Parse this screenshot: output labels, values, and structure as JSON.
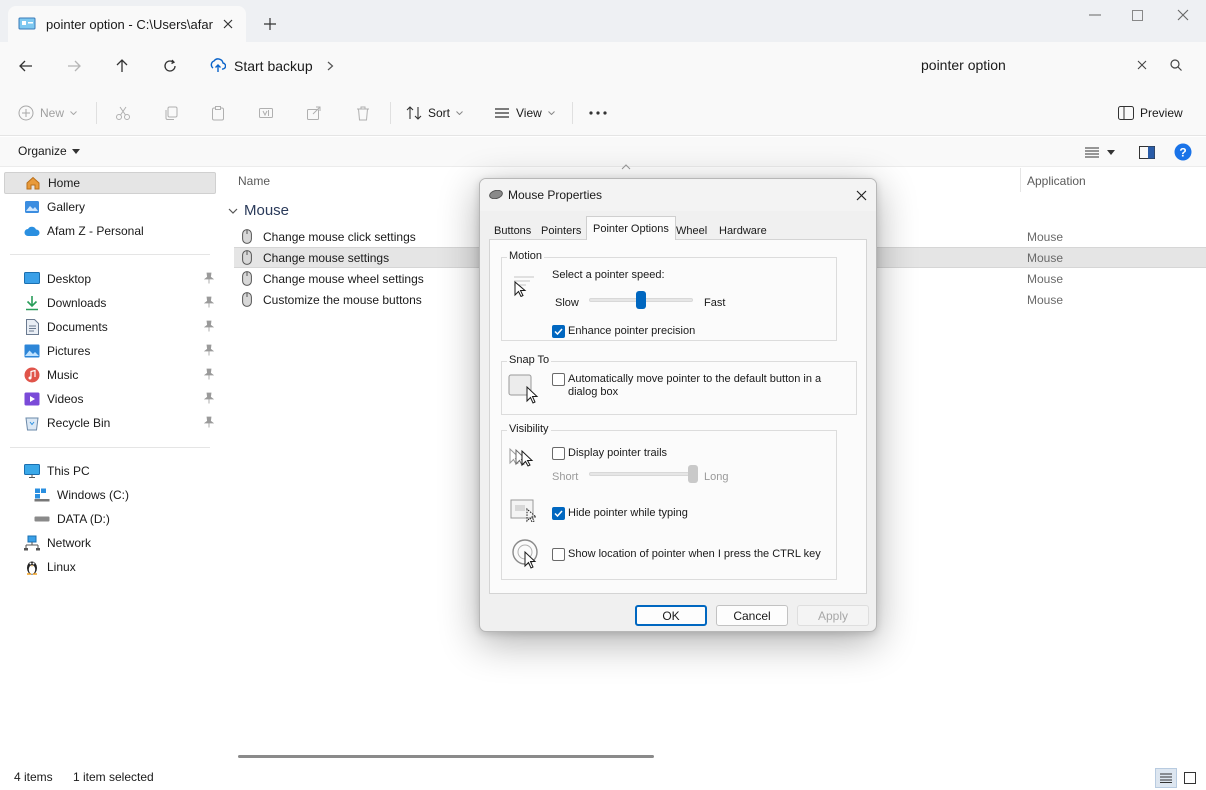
{
  "window": {
    "tab_title": "pointer option - C:\\Users\\afar"
  },
  "address": {
    "breadcrumb": "Start backup",
    "search_value": "pointer option"
  },
  "commands": {
    "new": "New",
    "sort": "Sort",
    "view": "View",
    "preview": "Preview",
    "organize": "Organize"
  },
  "sidebar": {
    "items": [
      {
        "label": "Home",
        "icon": "home-icon"
      },
      {
        "label": "Gallery",
        "icon": "gallery-icon"
      },
      {
        "label": "Afam Z - Personal",
        "icon": "onedrive-cloud-icon"
      },
      {
        "label": "Desktop",
        "icon": "desktop-icon"
      },
      {
        "label": "Downloads",
        "icon": "download-icon"
      },
      {
        "label": "Documents",
        "icon": "documents-icon"
      },
      {
        "label": "Pictures",
        "icon": "pictures-icon"
      },
      {
        "label": "Music",
        "icon": "music-icon"
      },
      {
        "label": "Videos",
        "icon": "videos-icon"
      },
      {
        "label": "Recycle Bin",
        "icon": "recycle-bin-icon"
      },
      {
        "label": "This PC",
        "icon": "monitor-icon"
      },
      {
        "label": "Windows (C:)",
        "icon": "drive-windows-icon"
      },
      {
        "label": "DATA (D:)",
        "icon": "drive-icon"
      },
      {
        "label": "Network",
        "icon": "network-icon"
      },
      {
        "label": "Linux",
        "icon": "linux-penguin-icon"
      }
    ]
  },
  "content": {
    "columns": {
      "name": "Name",
      "application": "Application"
    },
    "group": "Mouse",
    "rows": [
      {
        "name": "Change mouse click settings",
        "app": "Mouse"
      },
      {
        "name": "Change mouse settings",
        "app": "Mouse"
      },
      {
        "name": "Change mouse wheel settings",
        "app": "Mouse"
      },
      {
        "name": "Customize the mouse buttons",
        "app": "Mouse"
      }
    ]
  },
  "status": {
    "count": "4 items",
    "selection": "1 item selected"
  },
  "dialog": {
    "title": "Mouse Properties",
    "tabs": [
      "Buttons",
      "Pointers",
      "Pointer Options",
      "Wheel",
      "Hardware"
    ],
    "active_tab": "Pointer Options",
    "motion": {
      "label": "Motion",
      "speed_label": "Select a pointer speed:",
      "slow": "Slow",
      "fast": "Fast",
      "speed_fraction": 0.5,
      "enhance_label": "Enhance pointer precision",
      "enhance_checked": true
    },
    "snap": {
      "label": "Snap To",
      "auto_label": "Automatically move pointer to the default button in a dialog box",
      "auto_checked": false
    },
    "visibility": {
      "label": "Visibility",
      "trails_label": "Display pointer trails",
      "trails_checked": false,
      "short": "Short",
      "long": "Long",
      "trails_fraction": 1.0,
      "hide_label": "Hide pointer while typing",
      "hide_checked": true,
      "ctrl_label": "Show location of pointer when I press the CTRL key",
      "ctrl_checked": false
    },
    "buttons": {
      "ok": "OK",
      "cancel": "Cancel",
      "apply": "Apply"
    }
  },
  "colors": {
    "accent": "#0067c0",
    "selection": "#e5e5e5",
    "help": "#1a73e8"
  }
}
